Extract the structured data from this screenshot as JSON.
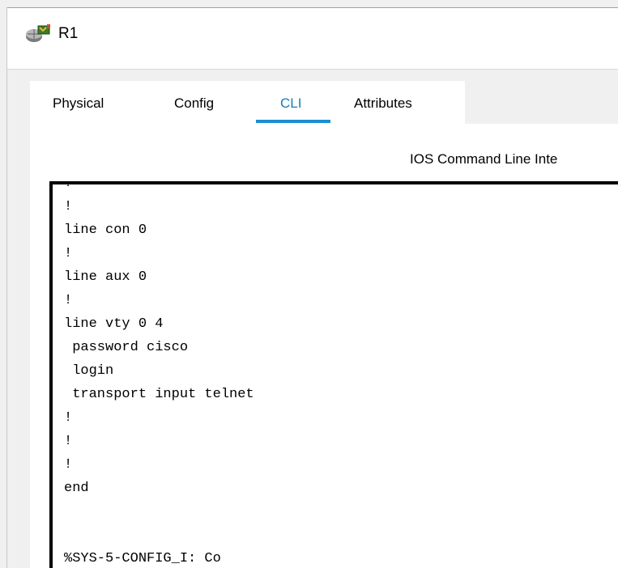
{
  "window": {
    "title": "R1",
    "icon": "router-icon"
  },
  "tabs": [
    {
      "label": "Physical",
      "active": false
    },
    {
      "label": "Config",
      "active": false
    },
    {
      "label": "CLI",
      "active": true
    },
    {
      "label": "Attributes",
      "active": false
    }
  ],
  "cli": {
    "header": "IOS Command Line Inte",
    "lines": [
      "!",
      "!",
      "line con 0",
      "!",
      "line aux 0",
      "!",
      "line vty 0 4",
      " password cisco",
      " login",
      " transport input telnet",
      "!",
      "!",
      "!",
      "end",
      "",
      "",
      "%SYS-5-CONFIG_I: Co"
    ]
  },
  "colors": {
    "accent": "#1a8fd0",
    "active_tab_text": "#1a7ab8",
    "window_bg": "#f0f0f0",
    "panel_bg": "#ffffff",
    "terminal_border": "#000000"
  }
}
